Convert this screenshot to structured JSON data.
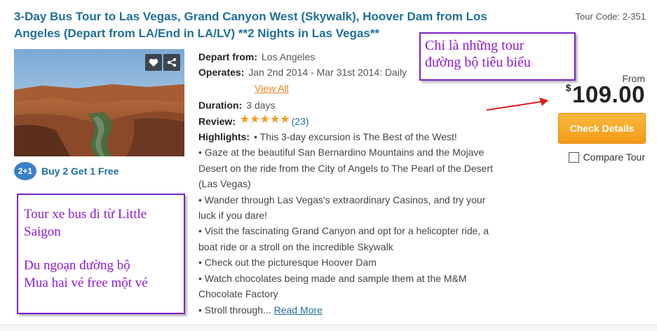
{
  "tour": {
    "title": "3-Day Bus Tour to Las Vegas, Grand Canyon West (Skywalk), Hoover Dam from Los Angeles (Depart from LA/End in LA/LV) **2 Nights in Las Vegas**",
    "code_label": "Tour Code: 2-351"
  },
  "photo": {
    "icons": [
      "heart-icon",
      "share-icon"
    ]
  },
  "promo": {
    "badge": "2+1",
    "label": "Buy 2 Get 1 Free",
    "color": "#3a7fc7"
  },
  "details": {
    "depart_label": "Depart from:",
    "depart_value": "Los Angeles",
    "operates_label": "Operates:",
    "operates_value": "Jan 2nd 2014 - Mar 31st 2014: Daily",
    "view_all": "View All",
    "duration_label": "Duration:",
    "duration_value": "3 days",
    "review_label": "Review:",
    "rating": 5,
    "review_count": "(23)",
    "highlights_label": "Highlights:",
    "highlights_first": "• This 3-day excursion is The Best of the West!",
    "highlights_lines": [
      "• Gaze at the beautiful San Bernardino Mountains and the Mojave",
      "Desert on the ride from the City of Angels to The Pearl of the Desert",
      "(Las Vegas)",
      "• Wander through Las Vegas's extraordinary Casinos, and try your",
      "luck if you dare!",
      "• Visit the fascinating Grand Canyon and opt for a helicopter ride, a",
      "boat ride or a stroll on the incredible Skywalk",
      "• Check out the picturesque Hoover Dam",
      "• Watch chocolates being made and sample them at the M&M",
      "Chocolate Factory"
    ],
    "highlights_last": "• Stroll through...",
    "read_more": "Read More"
  },
  "pricing": {
    "from_label": "From",
    "currency": "$",
    "amount": "109.00",
    "check_details": "Check Details",
    "compare_label": "Compare Tour",
    "button_color": "#f49b17"
  },
  "annotations": {
    "top_note": [
      "Chỉ là những tour",
      "đường bộ tiêu biểu"
    ],
    "left_note_p1": "Tour xe bus đi từ Little Saigon",
    "left_note_p2_lines": [
      "Du ngoạn đường bộ",
      "Mua hai vé free một vé"
    ],
    "note_color": "#8b1ad6",
    "arrow_color": "#e01b1b"
  }
}
